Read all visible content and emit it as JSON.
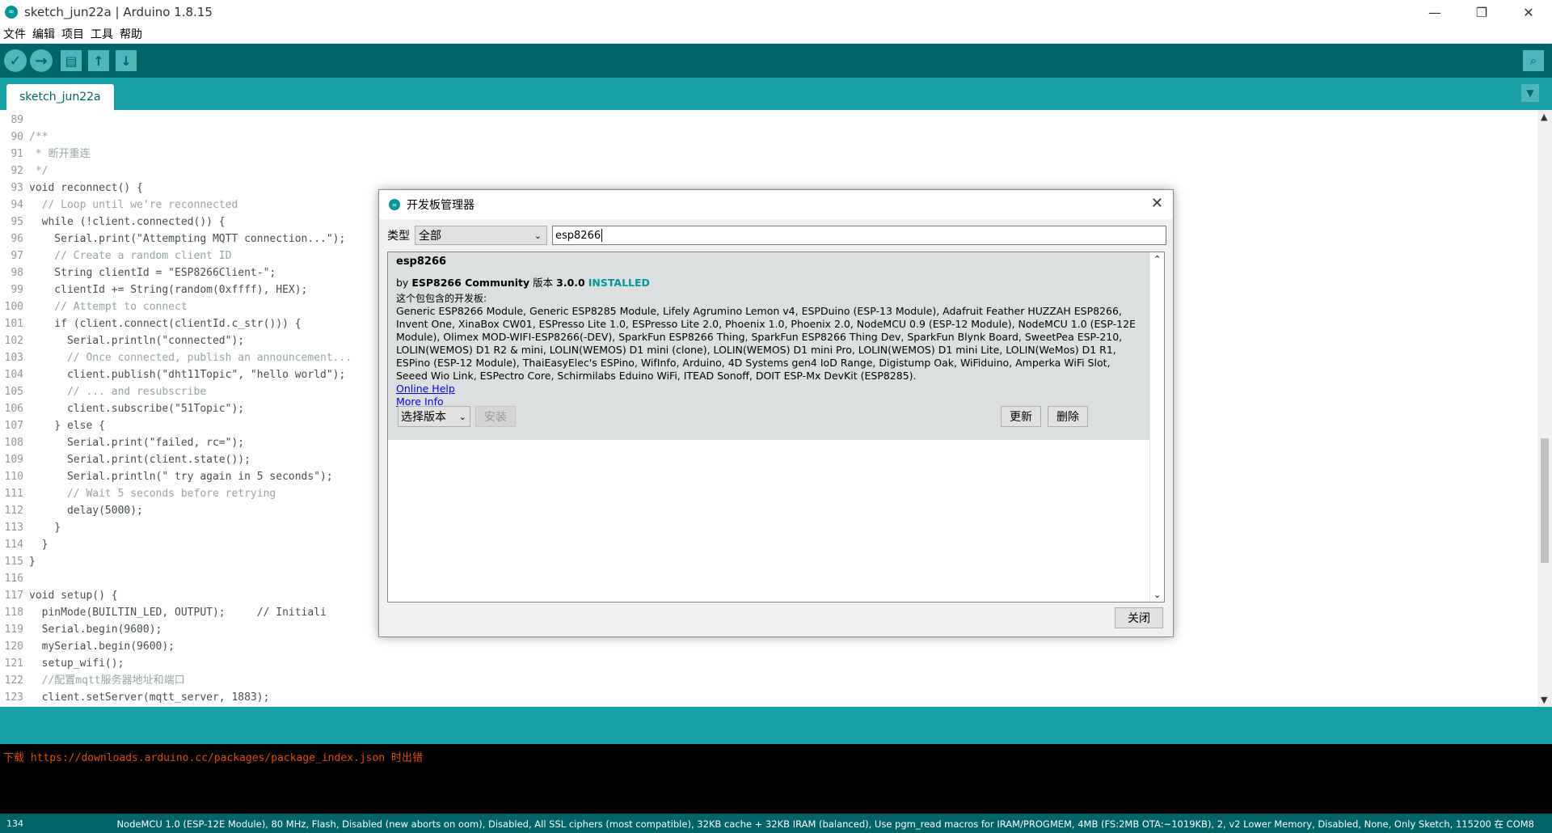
{
  "window": {
    "title": "sketch_jun22a | Arduino 1.8.15",
    "controls": {
      "minimize": "—",
      "restore": "❐",
      "close": "✕"
    }
  },
  "menu": [
    "文件",
    "编辑",
    "项目",
    "工具",
    "帮助"
  ],
  "toolbar": {
    "verify_icon": "✓",
    "upload_icon": "→",
    "new_icon": "▤",
    "open_icon": "↑",
    "save_icon": "↓",
    "serial_icon": "⌕"
  },
  "tabs": {
    "active": "sketch_jun22a",
    "menu_icon": "▼"
  },
  "editor": {
    "lines": [
      {
        "n": "89",
        "t": ""
      },
      {
        "n": "90",
        "t": "/**"
      },
      {
        "n": "91",
        "t": " * 断开重连"
      },
      {
        "n": "92",
        "t": " */"
      },
      {
        "n": "93",
        "t": "void reconnect() {"
      },
      {
        "n": "94",
        "t": "  // Loop until we're reconnected"
      },
      {
        "n": "95",
        "t": "  while (!client.connected()) {"
      },
      {
        "n": "96",
        "t": "    Serial.print(\"Attempting MQTT connection...\");"
      },
      {
        "n": "97",
        "t": "    // Create a random client ID"
      },
      {
        "n": "98",
        "t": "    String clientId = \"ESP8266Client-\";"
      },
      {
        "n": "99",
        "t": "    clientId += String(random(0xffff), HEX);"
      },
      {
        "n": "100",
        "t": "    // Attempt to connect"
      },
      {
        "n": "101",
        "t": "    if (client.connect(clientId.c_str())) {"
      },
      {
        "n": "102",
        "t": "      Serial.println(\"connected\");"
      },
      {
        "n": "103",
        "t": "      // Once connected, publish an announcement..."
      },
      {
        "n": "104",
        "t": "      client.publish(\"dht11Topic\", \"hello world\");"
      },
      {
        "n": "105",
        "t": "      // ... and resubscribe"
      },
      {
        "n": "106",
        "t": "      client.subscribe(\"51Topic\");"
      },
      {
        "n": "107",
        "t": "    } else {"
      },
      {
        "n": "108",
        "t": "      Serial.print(\"failed, rc=\");"
      },
      {
        "n": "109",
        "t": "      Serial.print(client.state());"
      },
      {
        "n": "110",
        "t": "      Serial.println(\" try again in 5 seconds\");"
      },
      {
        "n": "111",
        "t": "      // Wait 5 seconds before retrying"
      },
      {
        "n": "112",
        "t": "      delay(5000);"
      },
      {
        "n": "113",
        "t": "    }"
      },
      {
        "n": "114",
        "t": "  }"
      },
      {
        "n": "115",
        "t": "}"
      },
      {
        "n": "116",
        "t": ""
      },
      {
        "n": "117",
        "t": "void setup() {"
      },
      {
        "n": "118",
        "t": "  pinMode(BUILTIN_LED, OUTPUT);     // Initiali"
      },
      {
        "n": "119",
        "t": "  Serial.begin(9600);"
      },
      {
        "n": "120",
        "t": "  mySerial.begin(9600);"
      },
      {
        "n": "121",
        "t": "  setup_wifi();"
      },
      {
        "n": "122",
        "t": "  //配置mqtt服务器地址和端口"
      },
      {
        "n": "123",
        "t": "  client.setServer(mqtt_server, 1883);"
      }
    ]
  },
  "console": {
    "line": "下载 https://downloads.arduino.cc/packages/package_index.json 时出错"
  },
  "statusbar": {
    "line_number": "134",
    "board_info": "NodeMCU 1.0 (ESP-12E Module), 80 MHz, Flash, Disabled (new aborts on oom), Disabled, All SSL ciphers (most compatible), 32KB cache + 32KB IRAM (balanced), Use pgm_read macros for IRAM/PROGMEM, 4MB (FS:2MB OTA:~1019KB), 2, v2 Lower Memory, Disabled, None, Only Sketch, 115200 在 COM8"
  },
  "dialog": {
    "title": "开发板管理器",
    "close_icon": "✕",
    "filter_label": "类型",
    "type_value": "全部",
    "search_value": "esp8266",
    "entry": {
      "name": "esp8266",
      "by_prefix": "by ",
      "author": "ESP8266 Community",
      "version_label": " 版本 ",
      "version": "3.0.0",
      "installed": "INSTALLED",
      "contains_label": "这个包包含的开发板:",
      "boards": "Generic ESP8266 Module, Generic ESP8285 Module, Lifely Agrumino Lemon v4, ESPDuino (ESP-13 Module), Adafruit Feather HUZZAH ESP8266, Invent One, XinaBox CW01, ESPresso Lite 1.0, ESPresso Lite 2.0, Phoenix 1.0, Phoenix 2.0, NodeMCU 0.9 (ESP-12 Module), NodeMCU 1.0 (ESP-12E Module), Olimex MOD-WIFI-ESP8266(-DEV), SparkFun ESP8266 Thing, SparkFun ESP8266 Thing Dev, SparkFun Blynk Board, SweetPea ESP-210, LOLIN(WEMOS) D1 R2 & mini, LOLIN(WEMOS) D1 mini (clone), LOLIN(WEMOS) D1 mini Pro, LOLIN(WEMOS) D1 mini Lite, LOLIN(WeMos) D1 R1, ESPino (ESP-12 Module), ThaiEasyElec's ESPino, WifInfo, Arduino, 4D Systems gen4 IoD Range, Digistump Oak, WiFiduino, Amperka WiFi Slot, Seeed Wio Link, ESPectro Core, Schirmilabs Eduino WiFi, ITEAD Sonoff, DOIT ESP-Mx DevKit (ESP8285).",
      "online_help": "Online Help",
      "more_info": "More Info",
      "select_version": "选择版本",
      "install": "安装",
      "update": "更新",
      "remove": "删除"
    },
    "close_button": "关闭"
  }
}
